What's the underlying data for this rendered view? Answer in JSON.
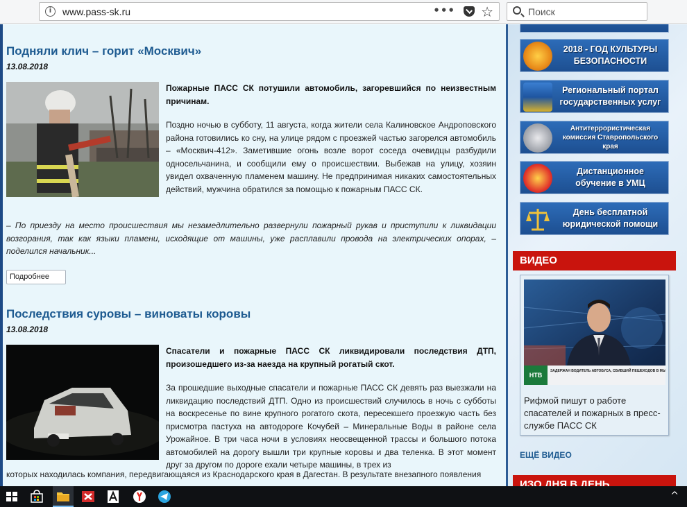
{
  "browser": {
    "url": "www.pass-sk.ru",
    "search_placeholder": "Поиск",
    "page_actions": "•••"
  },
  "articles": [
    {
      "title": "Подняли клич – горит «Москвич»",
      "date": "13.08.2018",
      "lead": "Пожарные ПАСС СК потушили автомобиль, загоревшийся по неизвестным причинам.",
      "body": "Поздно ночью в субботу, 11 августа, когда жители села Калиновское Андроповского района готовились ко сну, на улице рядом с проезжей частью загорелся автомобиль – «Москвич-412». Заметившие огонь возле ворот соседа очевидцы разбудили односельчанина, и сообщили ему о происшествии. Выбежав на улицу, хозяин увидел охваченную пламенем машину. Не предпринимая никаких самостоятельных действий, мужчина обратился за помощью к пожарным ПАСС СК.",
      "quote": "– По приезду на место происшествия мы незамедлительно развернули пожарный рукав и приступили к ликвидации возгорания, так как языки пламени, исходящие от машины, уже расплавили провода на электрических опорах, – поделился начальник...",
      "more_label": "Подробнее"
    },
    {
      "title": "Последствия суровы – виноваты коровы",
      "date": "13.08.2018",
      "lead": "Спасатели и пожарные ПАСС СК ликвидировали последствия ДТП, произошедшего из-за наезда на крупный рогатый скот.",
      "body": "За прошедшие выходные спасатели и пожарные ПАСС СК девять раз выезжали на ликвидацию последствий ДТП. Одно из происшествий случилось в ночь с субботы на воскресенье по вине крупного рогатого скота, пересекшего проезжую часть без присмотра пастуха на автодороге Кочубей – Минеральные Воды в районе села Урожайное. В три часа ночи в условиях неосвещенной трассы и большого потока автомобилей на дорогу  вышли три крупные коровы и два теленка. В этот момент друг за другом по дороге ехали четыре машины, в трех из",
      "body_cont": "которых находилась компания, передвигающаяся из Краснодарского края в Дагестан. В результате внезапного появления"
    }
  ],
  "sidebar": {
    "banners": [
      {
        "line1": "2018 - ГОД КУЛЬТУРЫ",
        "line2": "БЕЗОПАСНОСТИ",
        "color": "#e88b1a"
      },
      {
        "line1": "Региональный портал",
        "line2": "государственных услуг",
        "color": "#2c6db8"
      },
      {
        "line1": "Антитеррористическая",
        "line2": "комиссия Ставропольского края",
        "color": "#9a9ea6"
      },
      {
        "line1": "Дистанционное",
        "line2": "обучение в УМЦ",
        "color": "#e0312a"
      },
      {
        "line1": "День бесплатной",
        "line2": "юридической помощи",
        "color": "#d4a21d"
      }
    ],
    "video_header": "ВИДЕО",
    "video_caption": "Рифмой пишут о работе спасателей и пожарных в пресс-службе ПАСС СК",
    "video_ticker": "ЗАДЕРЖАН ВОДИТЕЛЬ АВТОБУСА, СБИВШИЙ ПЕШЕХОДОВ В МЫТИЩАХ",
    "video_channel": "НТВ",
    "more_video": "ЕЩЁ ВИДЕО",
    "next_header": "ИЗО ДНЯ В ДЕНЬ"
  },
  "taskbar": {
    "items": [
      "start-icon",
      "store-icon",
      "file-explorer-icon",
      "app-icon",
      "font-app-icon",
      "yandex-browser-icon",
      "telegram-icon"
    ],
    "tray": "^"
  }
}
